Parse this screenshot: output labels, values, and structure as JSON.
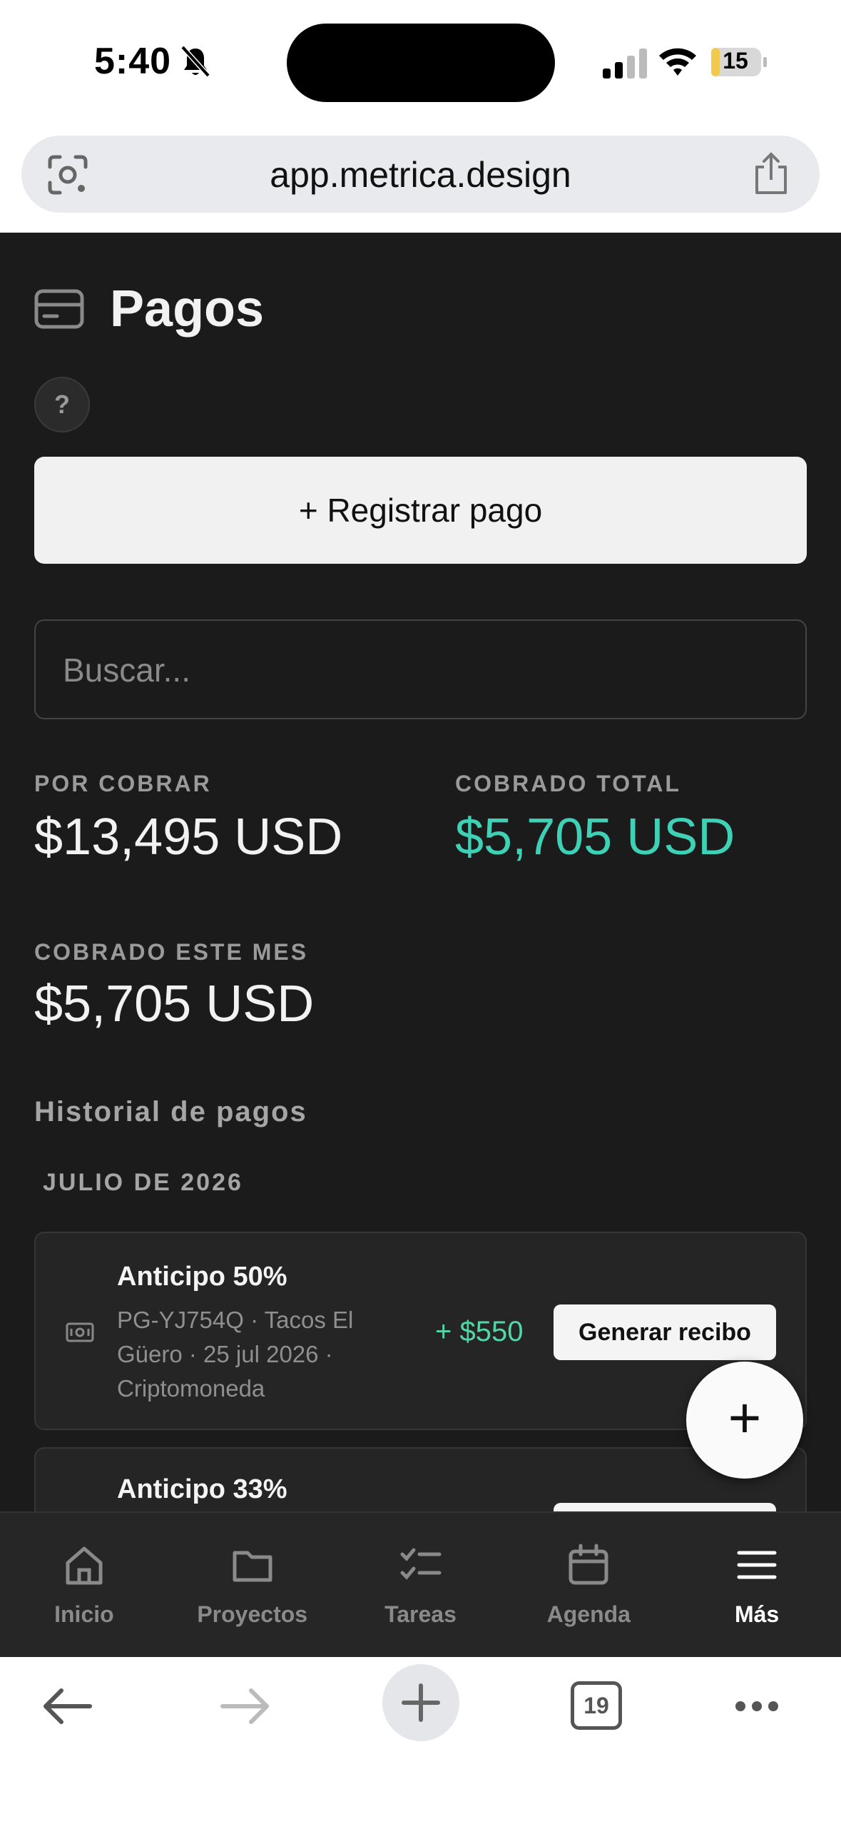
{
  "status_bar": {
    "time": "5:40",
    "battery": "15"
  },
  "browser": {
    "url": "app.metrica.design",
    "tabs_count": "19"
  },
  "page": {
    "title": "Pagos",
    "help_label": "?",
    "register_button": "+ Registrar pago",
    "search_placeholder": "Buscar..."
  },
  "stats": {
    "por_cobrar": {
      "label": "POR COBRAR",
      "value": "$13,495 USD"
    },
    "cobrado_total": {
      "label": "COBRADO TOTAL",
      "value": "$5,705 USD"
    },
    "cobrado_mes": {
      "label": "COBRADO ESTE MES",
      "value": "$5,705 USD"
    }
  },
  "history": {
    "title": "Historial de pagos",
    "month": "JULIO DE 2026",
    "payments": [
      {
        "title": "Anticipo 50%",
        "meta": "PG-YJ754Q · Tacos El Güero · 25 jul 2026 · Criptomoneda",
        "amount": "+ $550",
        "action": "Generar recibo"
      },
      {
        "title": "Anticipo 33%",
        "meta": "",
        "amount": "",
        "action": ""
      }
    ]
  },
  "fab_label": "+",
  "nav": {
    "items": [
      {
        "label": "Inicio",
        "icon": "home-icon"
      },
      {
        "label": "Proyectos",
        "icon": "folder-icon"
      },
      {
        "label": "Tareas",
        "icon": "checklist-icon"
      },
      {
        "label": "Agenda",
        "icon": "calendar-icon"
      },
      {
        "label": "Más",
        "icon": "menu-icon"
      }
    ]
  },
  "colors": {
    "accent_teal": "#3fd1b6",
    "amount_green": "#53d6a7",
    "background": "#1b1b1b"
  }
}
